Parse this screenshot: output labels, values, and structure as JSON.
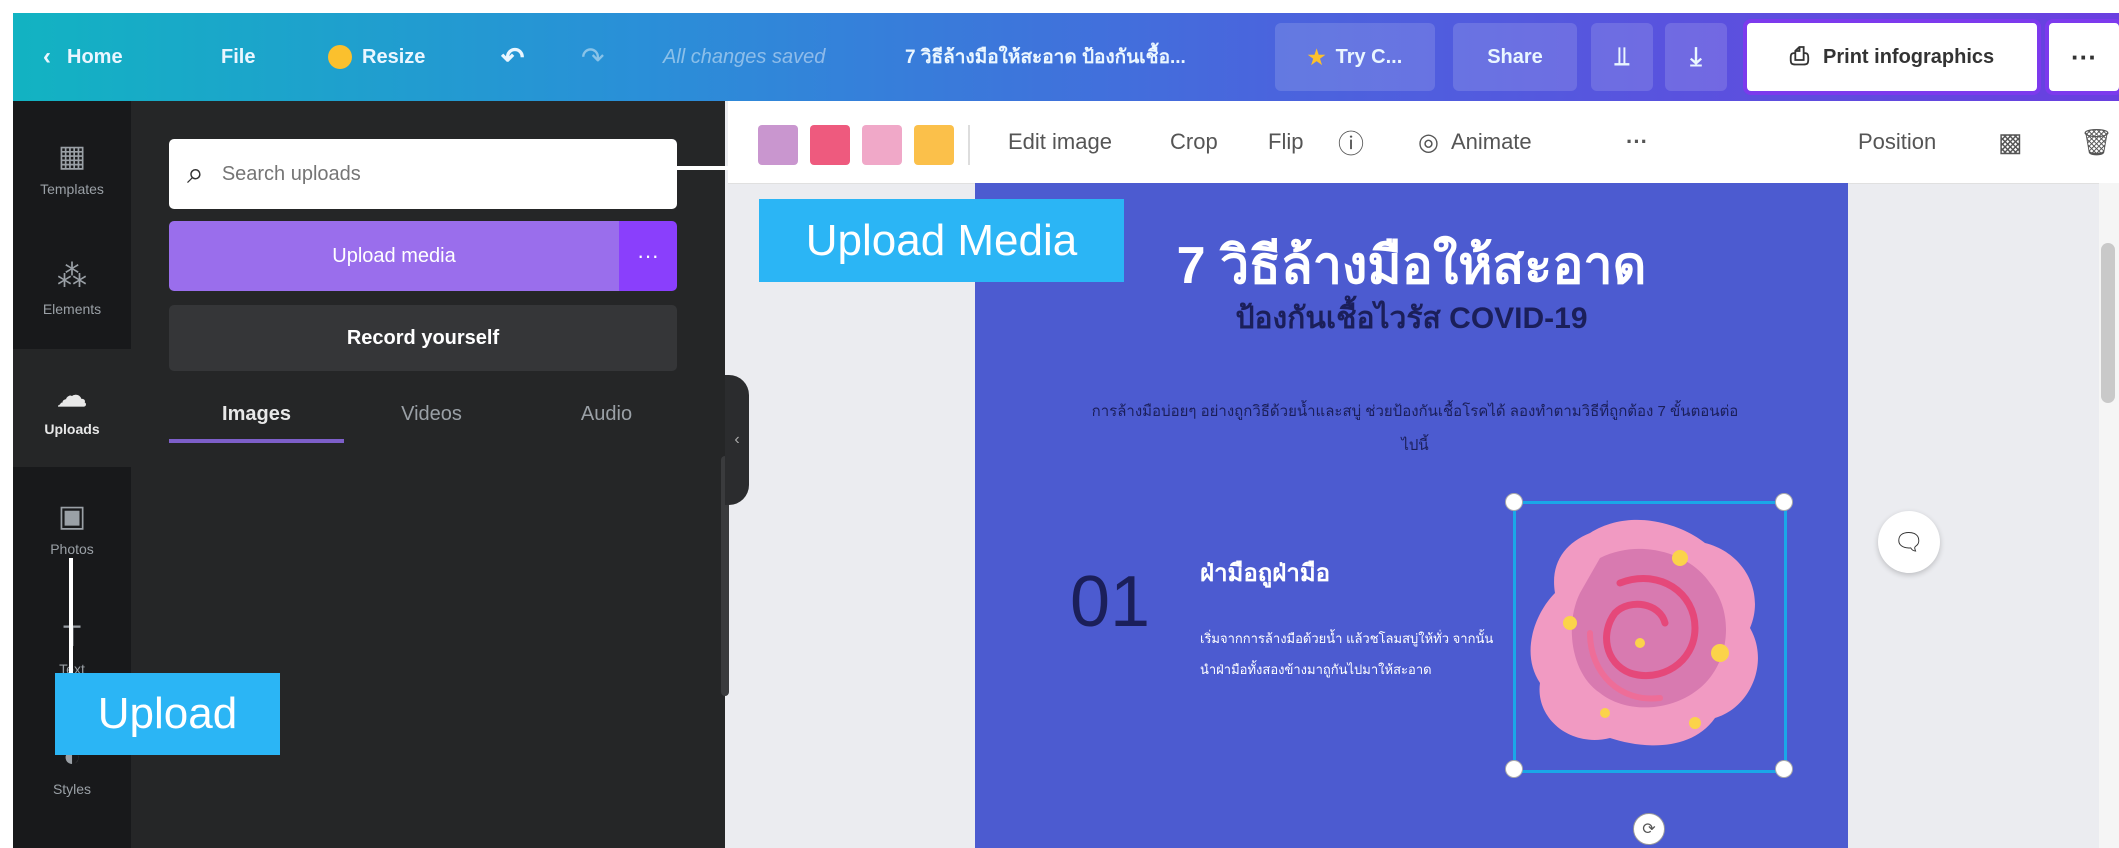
{
  "topbar": {
    "home": "Home",
    "file": "File",
    "resize": "Resize",
    "saved_status": "All changes saved",
    "doc_title": "7 วิธีล้างมือให้สะอาด ป้องกันเชื้อ...",
    "try_label": "Try C...",
    "share_label": "Share",
    "print_label": "Print infographics",
    "more_label": "···"
  },
  "rail": {
    "items": [
      {
        "label": "Templates",
        "icon": "templates-icon"
      },
      {
        "label": "Elements",
        "icon": "elements-icon"
      },
      {
        "label": "Uploads",
        "icon": "upload-cloud-icon"
      },
      {
        "label": "Photos",
        "icon": "photos-icon"
      },
      {
        "label": "Text",
        "icon": "text-icon"
      },
      {
        "label": "Styles",
        "icon": "styles-icon"
      }
    ]
  },
  "panel": {
    "search_placeholder": "Search uploads",
    "upload_label": "Upload media",
    "upload_more": "···",
    "record_label": "Record yourself",
    "tabs": [
      "Images",
      "Videos",
      "Audio"
    ],
    "active_tab": "Images"
  },
  "toolbar": {
    "swatches": [
      "#c996cf",
      "#ee5a7e",
      "#f0a8c8",
      "#fbc04a"
    ],
    "edit_image": "Edit image",
    "crop": "Crop",
    "flip": "Flip",
    "animate": "Animate",
    "more": "···",
    "position": "Position"
  },
  "canvas": {
    "title": "7 วิธีล้างมือให้สะอาด",
    "subtitle": "ป้องกันเชื้อไวรัส COVID-19",
    "intro": "การล้างมือบ่อยๆ อย่างถูกวิธีด้วยน้ำและสบู่ ช่วยป้องกันเชื้อโรคได้ ลองทำตามวิธีที่ถูกต้อง 7 ขั้นตอนต่อไปนี้",
    "step_number": "01",
    "step_title": "ฝ่ามือถูฝ่ามือ",
    "step_body": "เริ่มจากการล้างมือด้วยน้ำ แล้วชโลมสบู่ให้ทั่ว จากนั้นนำฝ่ามือทั้งสองข้างมาถูกันไปมาให้สะอาด"
  },
  "callouts": {
    "upload_media": "Upload Media",
    "upload": "Upload"
  },
  "colors": {
    "accent": "#8a3ffc",
    "callout": "#2bb5f5",
    "page_bg": "#4c5bd0"
  }
}
